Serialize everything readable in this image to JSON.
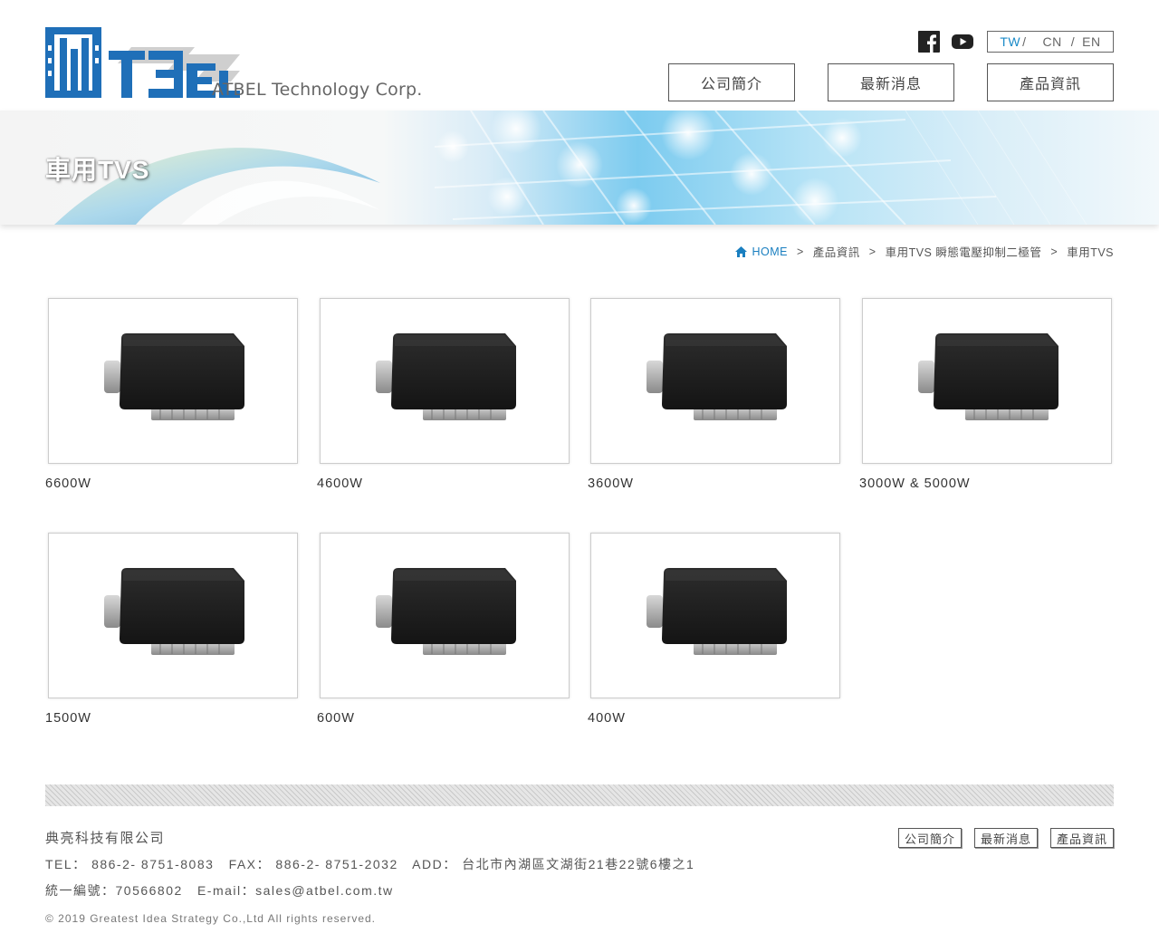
{
  "header": {
    "logo_text": "ATBEL Technology Corp.",
    "social": [
      {
        "name": "facebook-icon"
      },
      {
        "name": "youtube-icon"
      }
    ],
    "languages": [
      "TW",
      "CN",
      "EN"
    ],
    "active_language": "TW",
    "nav": [
      "公司簡介",
      "最新消息",
      "產品資訊"
    ]
  },
  "banner": {
    "title": "車用TVS"
  },
  "breadcrumb": {
    "home": "HOME",
    "items": [
      "產品資訊",
      "車用TVS 瞬態電壓抑制二極管",
      "車用TVS"
    ]
  },
  "products": [
    {
      "label": "6600W"
    },
    {
      "label": "4600W"
    },
    {
      "label": "3600W"
    },
    {
      "label": "3000W & 5000W"
    },
    {
      "label": "1500W"
    },
    {
      "label": "600W"
    },
    {
      "label": "400W"
    }
  ],
  "footer": {
    "company": "典亮科技有限公司",
    "tel_label": "TEL：",
    "tel": "886-2- 8751-8083",
    "fax_label": "FAX：",
    "fax": "886-2- 8751-2032",
    "add_label": "ADD：",
    "address": "台北市內湖區文湖街21巷22號6樓之1",
    "tax_label": "統一編號：",
    "tax_id": "70566802",
    "email_label": "E-mail：",
    "email": "sales@atbel.com.tw",
    "copyright": "© 2019 Greatest Idea Strategy Co.,Ltd All rights reserved.",
    "nav": [
      "公司簡介",
      "最新消息",
      "產品資訊"
    ]
  },
  "colors": {
    "accent": "#1a8ac8",
    "logo_blue": "#1f6fb8"
  }
}
